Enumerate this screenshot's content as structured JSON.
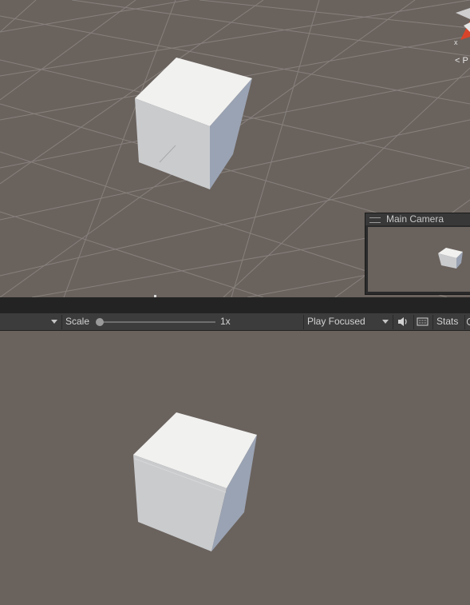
{
  "scene": {
    "gizmo_axis_label": "x",
    "persp_label": "< P"
  },
  "camera_preview": {
    "title": "Main Camera"
  },
  "game_toolbar": {
    "scale_label": "Scale",
    "scale_value": "1x",
    "scale_slider_level": 0,
    "play_mode": "Play Focused",
    "stats_label": "Stats"
  },
  "colors": {
    "background": "#6a625d",
    "toolbar": "#3c3c3c",
    "divider": "#232323",
    "cube_top": "#f1f1f0",
    "cube_front": "#c9cbcd",
    "cube_side": "#9aa3b3",
    "gizmo_red": "#d8442a"
  }
}
